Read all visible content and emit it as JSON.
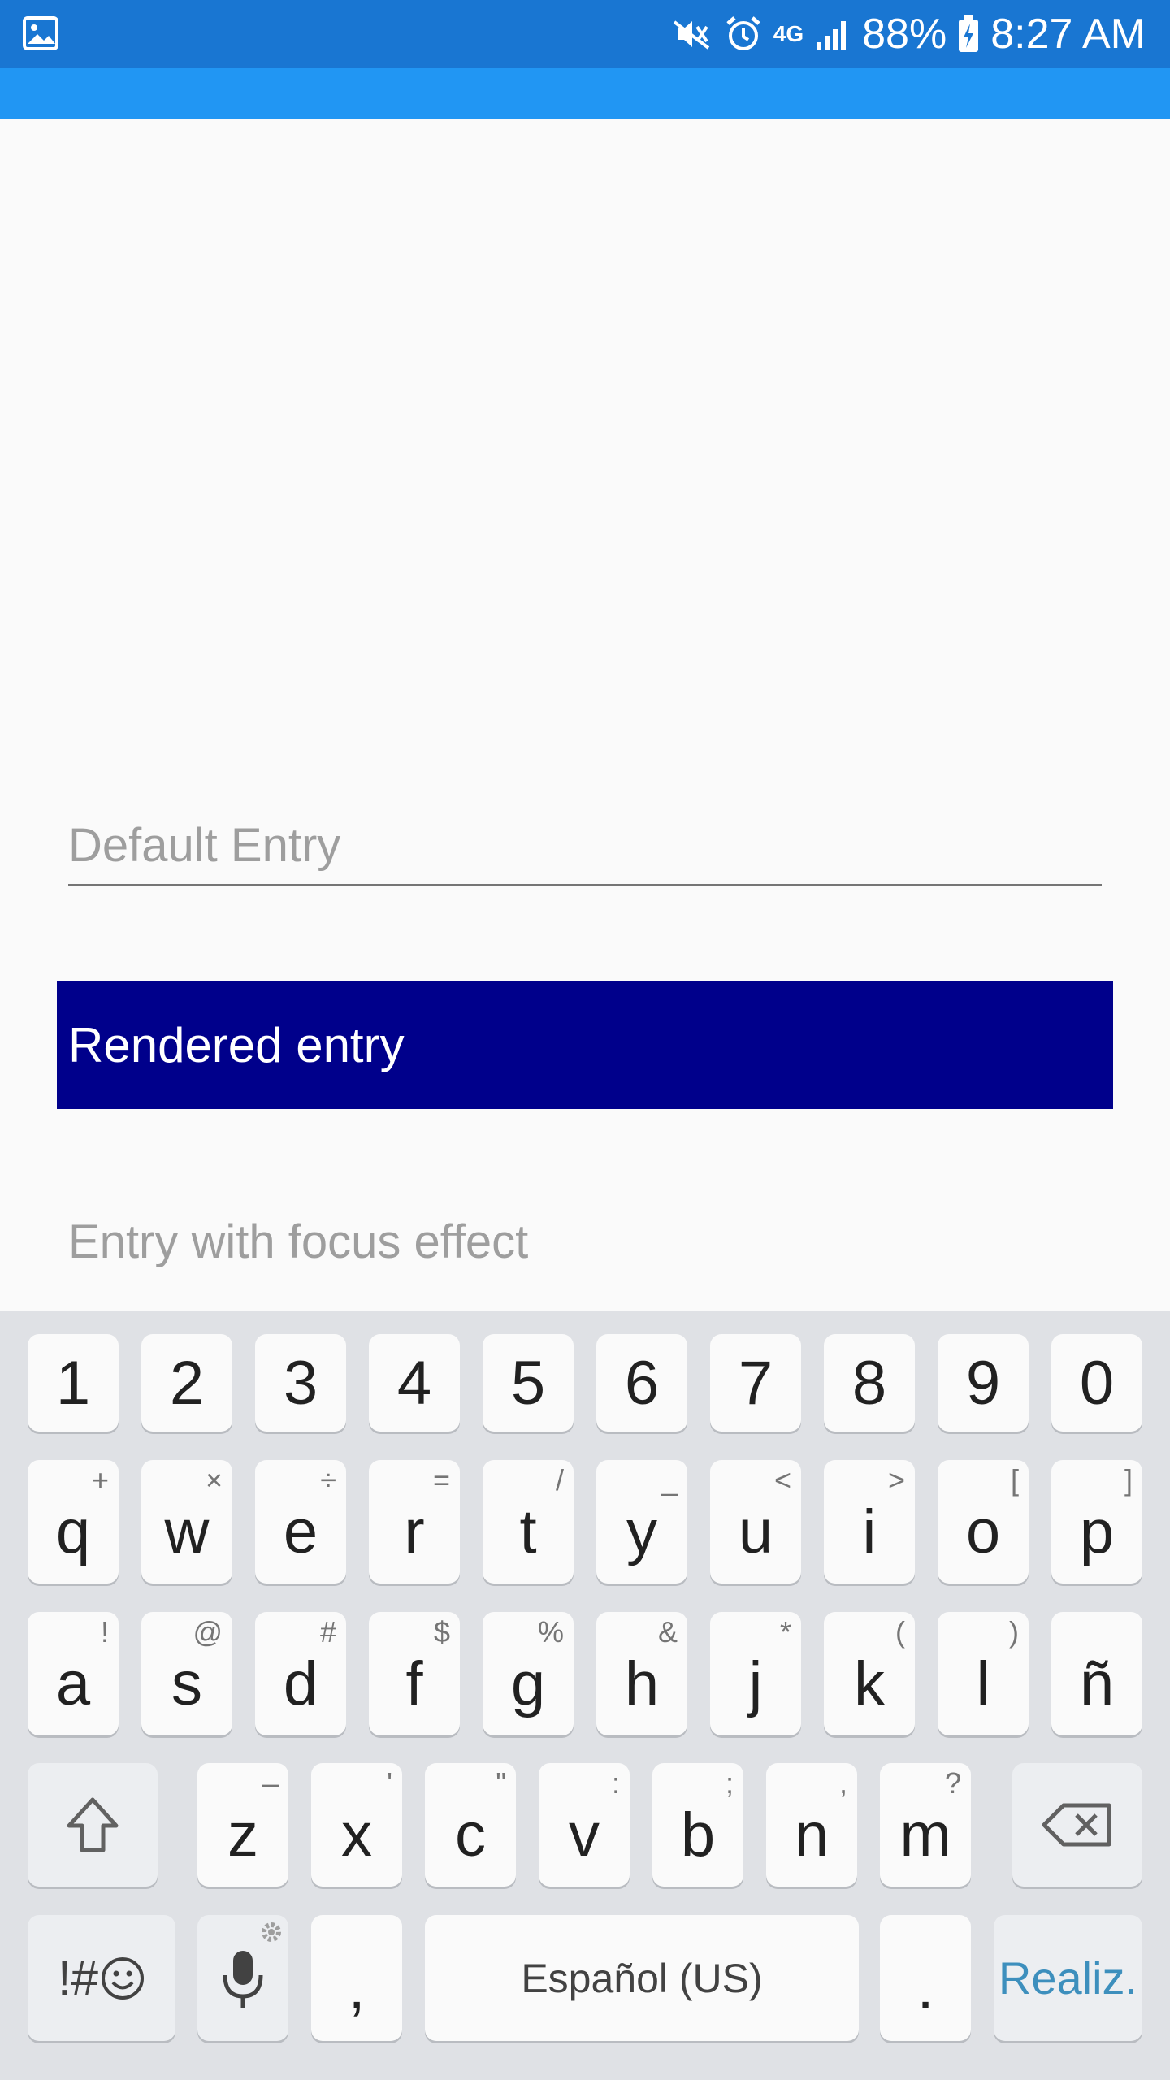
{
  "status_bar": {
    "battery": "88%",
    "time": "8:27 AM",
    "network": "4G",
    "icons": [
      "gallery-icon",
      "vibrate-icon",
      "alarm-icon",
      "network-4g-icon",
      "signal-icon",
      "battery-charging-icon"
    ]
  },
  "entries": {
    "default_placeholder": "Default Entry",
    "rendered_text": "Rendered entry",
    "focus_placeholder": "Entry with focus effect",
    "rendered_bg": "#00008b",
    "rendered_fg": "#ffffff"
  },
  "keyboard": {
    "numbers": [
      "1",
      "2",
      "3",
      "4",
      "5",
      "6",
      "7",
      "8",
      "9",
      "0"
    ],
    "row1": [
      {
        "k": "q",
        "h": "+"
      },
      {
        "k": "w",
        "h": "×"
      },
      {
        "k": "e",
        "h": "÷"
      },
      {
        "k": "r",
        "h": "="
      },
      {
        "k": "t",
        "h": "/"
      },
      {
        "k": "y",
        "h": "_"
      },
      {
        "k": "u",
        "h": "<"
      },
      {
        "k": "i",
        "h": ">"
      },
      {
        "k": "o",
        "h": "["
      },
      {
        "k": "p",
        "h": "]"
      }
    ],
    "row2": [
      {
        "k": "a",
        "h": "!"
      },
      {
        "k": "s",
        "h": "@"
      },
      {
        "k": "d",
        "h": "#"
      },
      {
        "k": "f",
        "h": "$"
      },
      {
        "k": "g",
        "h": "%"
      },
      {
        "k": "h",
        "h": "&"
      },
      {
        "k": "j",
        "h": "*"
      },
      {
        "k": "k",
        "h": "("
      },
      {
        "k": "l",
        "h": ")"
      },
      {
        "k": "ñ",
        "h": ""
      }
    ],
    "row3": [
      {
        "k": "z",
        "h": "–"
      },
      {
        "k": "x",
        "h": "'"
      },
      {
        "k": "c",
        "h": "\""
      },
      {
        "k": "v",
        "h": ":"
      },
      {
        "k": "b",
        "h": ";"
      },
      {
        "k": "n",
        "h": ","
      },
      {
        "k": "m",
        "h": "?"
      }
    ],
    "symbols_label": "!#",
    "comma": ",",
    "space_label": "Español (US)",
    "period": ".",
    "action_label": "Realiz.",
    "action_color": "#3d8fbd"
  }
}
